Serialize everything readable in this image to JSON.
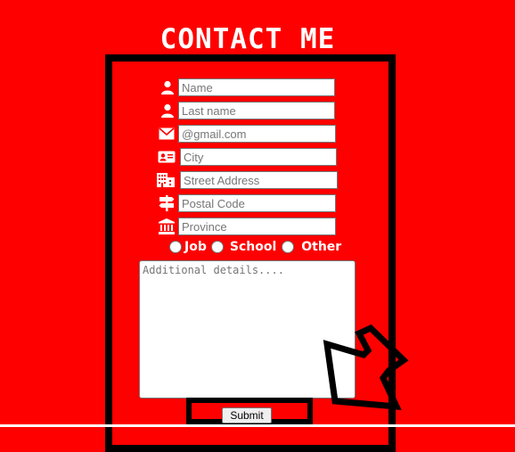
{
  "page": {
    "title": "CONTACT ME"
  },
  "fields": [
    {
      "id": "name",
      "icon": "user-icon",
      "placeholder": "Name"
    },
    {
      "id": "lastname",
      "icon": "user-icon",
      "placeholder": "Last name"
    },
    {
      "id": "email",
      "icon": "envelope-icon",
      "placeholder": "@gmail.com"
    },
    {
      "id": "city",
      "icon": "id-card-icon",
      "placeholder": "City"
    },
    {
      "id": "street",
      "icon": "building-icon",
      "placeholder": "Street Address"
    },
    {
      "id": "postal",
      "icon": "signpost-icon",
      "placeholder": "Postal Code"
    },
    {
      "id": "province",
      "icon": "landmark-icon",
      "placeholder": "Province"
    }
  ],
  "radios": [
    {
      "label": "Job"
    },
    {
      "label": "School"
    },
    {
      "label": "Other"
    }
  ],
  "details": {
    "placeholder": "Additional details...."
  },
  "submit": {
    "label": "Submit"
  },
  "colors": {
    "background": "#ff0000",
    "frame": "#000000",
    "title": "#ffffff"
  }
}
